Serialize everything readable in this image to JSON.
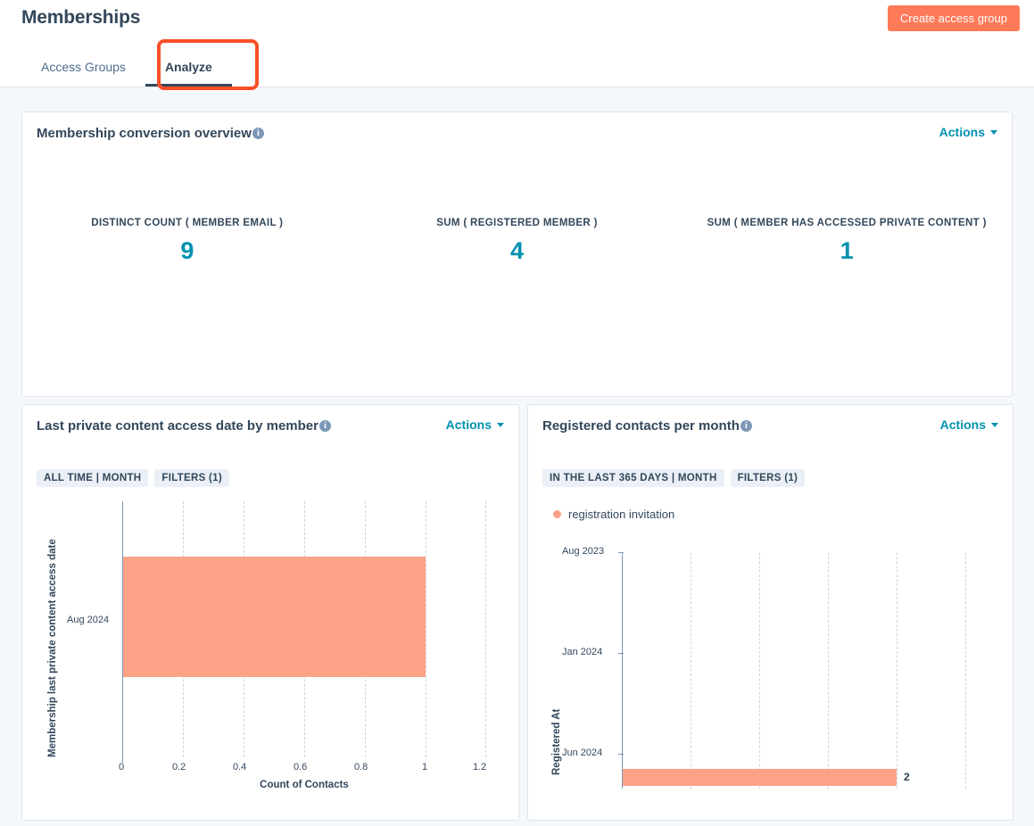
{
  "header": {
    "title": "Memberships",
    "create_button": "Create access group",
    "tabs": [
      {
        "label": "Access Groups",
        "active": false
      },
      {
        "label": "Analyze",
        "active": true
      }
    ]
  },
  "overview_card": {
    "title": "Membership conversion overview",
    "info_icon": "info-icon",
    "actions_label": "Actions",
    "metrics": [
      {
        "label": "DISTINCT COUNT ( MEMBER EMAIL )",
        "value": "9"
      },
      {
        "label": "SUM ( REGISTERED MEMBER )",
        "value": "4"
      },
      {
        "label": "SUM ( MEMBER HAS ACCESSED PRIVATE CONTENT )",
        "value": "1"
      }
    ]
  },
  "left_card": {
    "title": "Last private content access date by member",
    "info_icon": "info-icon",
    "actions_label": "Actions",
    "badges": [
      "ALL TIME | MONTH",
      "FILTERS (1)"
    ]
  },
  "right_card": {
    "title": "Registered contacts per month",
    "info_icon": "info-icon",
    "actions_label": "Actions",
    "badges": [
      "IN THE LAST 365 DAYS | MONTH",
      "FILTERS (1)"
    ]
  },
  "colors": {
    "brand_orange": "#ff7a59",
    "highlight_orange": "#fa4f27",
    "accent_teal": "#0091ae",
    "bar_salmon": "#fba287",
    "text_dark": "#33475b",
    "badge_bg": "#eaf0f6"
  },
  "chart_data": [
    {
      "type": "bar",
      "orientation": "horizontal",
      "title": "Last private content access date by member",
      "categories": [
        "Aug 2024"
      ],
      "values": [
        1
      ],
      "series": [
        {
          "name": "Count of Contacts",
          "values": [
            1
          ]
        }
      ],
      "xlabel": "Count of Contacts",
      "ylabel": "Membership last private content access date",
      "xticks": [
        "0",
        "0.2",
        "0.4",
        "0.6",
        "0.8",
        "1",
        "1.2"
      ],
      "xlim": [
        0,
        1.2
      ],
      "grid": true,
      "legend": null
    },
    {
      "type": "bar",
      "orientation": "horizontal",
      "title": "Registered contacts per month",
      "categories": [
        "Aug 2023",
        "Jan 2024",
        "Jun 2024"
      ],
      "values": [
        2
      ],
      "series": [
        {
          "name": "registration invitation",
          "values": [
            2
          ]
        }
      ],
      "data_labels": [
        "2"
      ],
      "xlabel": "",
      "ylabel": "Registered At",
      "yticks": [
        "Aug 2023",
        "Jan 2024",
        "Jun 2024"
      ],
      "grid": true,
      "legend": {
        "position": "top-left",
        "entries": [
          "registration invitation"
        ]
      }
    }
  ]
}
